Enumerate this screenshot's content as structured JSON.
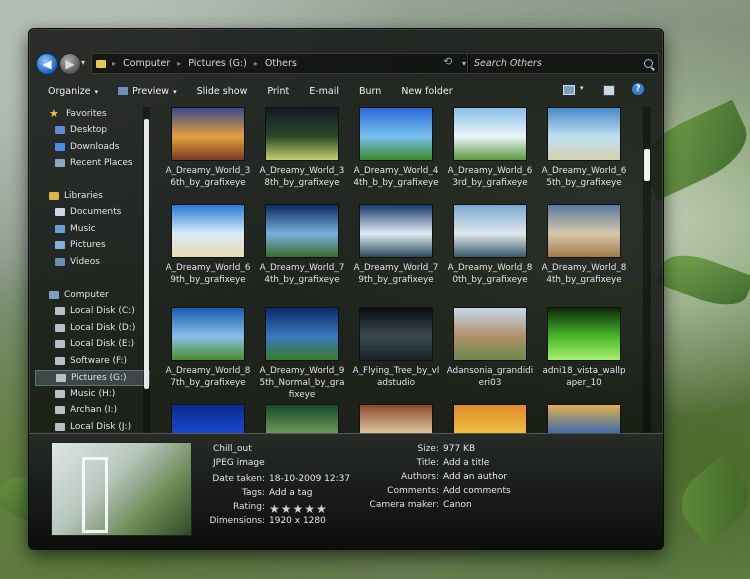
{
  "nav_buttons": {
    "back": "◀",
    "forward": "▶",
    "history": "▾"
  },
  "address": {
    "crumbs": [
      "Computer",
      "Pictures (G:)",
      "Others"
    ],
    "separator": "▸",
    "dropdown": "▾"
  },
  "search": {
    "placeholder": "Search Others"
  },
  "toolbar": {
    "items": [
      "Organize",
      "Preview",
      "Slide show",
      "Print",
      "E-mail",
      "Burn",
      "New folder"
    ],
    "arrow": "▾",
    "help": "?"
  },
  "nav": {
    "items": [
      {
        "label": "Favorites",
        "icon": "star-icon",
        "color": "#f4c430"
      },
      {
        "label": "Desktop",
        "icon": "desktop-icon",
        "color": "#5b8fd1"
      },
      {
        "label": "Downloads",
        "icon": "downloads-icon",
        "color": "#4a90e2"
      },
      {
        "label": "Recent Places",
        "icon": "recent-places-icon",
        "color": "#8fa8c2"
      },
      {
        "label": "Libraries",
        "icon": "libraries-icon",
        "color": "#d9b44a"
      },
      {
        "label": "Documents",
        "icon": "documents-icon",
        "color": "#cfd8e2"
      },
      {
        "label": "Music",
        "icon": "music-icon",
        "color": "#6aa0d8"
      },
      {
        "label": "Pictures",
        "icon": "pictures-icon",
        "color": "#7fb0e0"
      },
      {
        "label": "Videos",
        "icon": "videos-icon",
        "color": "#6c8cb0"
      },
      {
        "label": "Computer",
        "icon": "computer-icon",
        "color": "#7f9fbf"
      },
      {
        "label": "Local Disk (C:)",
        "icon": "disk-icon",
        "color": "#b8c0c8"
      },
      {
        "label": "Local Disk (D:)",
        "icon": "disk-icon",
        "color": "#b8c0c8"
      },
      {
        "label": "Local Disk (E:)",
        "icon": "disk-icon",
        "color": "#b8c0c8"
      },
      {
        "label": "Software (F:)",
        "icon": "disk-icon",
        "color": "#b8c0c8"
      },
      {
        "label": "Pictures (G:)",
        "icon": "disk-icon",
        "color": "#b8c0c8"
      },
      {
        "label": "Music (H:)",
        "icon": "disk-icon",
        "color": "#b8c0c8"
      },
      {
        "label": "Archan (I:)",
        "icon": "disk-icon",
        "color": "#b8c0c8"
      },
      {
        "label": "Local Disk (J:)",
        "icon": "disk-icon",
        "color": "#b8c0c8"
      }
    ]
  },
  "files": [
    {
      "name": "A_Dreamy_World_36th_by_grafixeye",
      "colors": [
        "#3a4a8a",
        "#e6a040",
        "#7a3a20"
      ]
    },
    {
      "name": "A_Dreamy_World_38th_by_grafixeye",
      "colors": [
        "#111a22",
        "#2a4a2a",
        "#c8d070"
      ]
    },
    {
      "name": "A_Dreamy_World_44th_b_by_grafixeye",
      "colors": [
        "#2a6ad8",
        "#7ac0f0",
        "#3a8a2a"
      ]
    },
    {
      "name": "A_Dreamy_World_63rd_by_grafixeye",
      "colors": [
        "#8ac0e8",
        "#eaf4fa",
        "#5a9a3a"
      ]
    },
    {
      "name": "A_Dreamy_World_65th_by_grafixeye",
      "colors": [
        "#4a8ac8",
        "#bfe0f0",
        "#d8d0b0"
      ]
    },
    {
      "name": "A_Dreamy_World_69th_by_grafixeye",
      "colors": [
        "#2a7ad0",
        "#d8ecf8",
        "#e8dcb0"
      ]
    },
    {
      "name": "A_Dreamy_World_74th_by_grafixeye",
      "colors": [
        "#0a2a5a",
        "#7ab0e0",
        "#3a6a2a"
      ]
    },
    {
      "name": "A_Dreamy_World_79th_by_grafixeye",
      "colors": [
        "#1a3a6a",
        "#e0ecf4",
        "#2a4a5a"
      ]
    },
    {
      "name": "A_Dreamy_World_80th_by_grafixeye",
      "colors": [
        "#7aa8d0",
        "#e0e8ee",
        "#3a5a6a"
      ]
    },
    {
      "name": "A_Dreamy_World_84th_by_grafixeye",
      "colors": [
        "#5a7aa0",
        "#d8c8a8",
        "#a07a4a"
      ]
    },
    {
      "name": "A_Dreamy_World_87th_by_grafixeye",
      "colors": [
        "#1a5ab0",
        "#8ac0e8",
        "#4a8a2a"
      ]
    },
    {
      "name": "A_Dreamy_World_95th_Normal_by_grafixeye",
      "colors": [
        "#0a2a6a",
        "#3a7ac0",
        "#3a7a2a"
      ]
    },
    {
      "name": "A_Flying_Tree_by_vladstudio",
      "colors": [
        "#0a0e12",
        "#3a4a52",
        "#1a2228"
      ]
    },
    {
      "name": "Adansonia_grandidieri03",
      "colors": [
        "#c8d8e8",
        "#b0906a",
        "#6a8a4a"
      ]
    },
    {
      "name": "adni18_vista_wallpaper_10",
      "colors": [
        "#0a2a0a",
        "#4ab82a",
        "#a8f070"
      ]
    },
    {
      "name": "",
      "colors": [
        "#0a2a8a",
        "#1a4ad0",
        "#0a1a5a"
      ]
    },
    {
      "name": "",
      "colors": [
        "#1a4a2a",
        "#6a9a5a",
        "#2a5a3a"
      ]
    },
    {
      "name": "",
      "colors": [
        "#8a4a2a",
        "#e0c8a0",
        "#b06a3a"
      ]
    },
    {
      "name": "",
      "colors": [
        "#e08a2a",
        "#f0c040",
        "#c04a2a"
      ]
    },
    {
      "name": "",
      "colors": [
        "#e0b050",
        "#3a6ab0",
        "#d05a3a"
      ]
    }
  ],
  "details": {
    "name": "Chill_out",
    "type": "JPEG image",
    "left": [
      {
        "key": "Date taken:",
        "value": "18-10-2009 12:37"
      },
      {
        "key": "Tags:",
        "value": "Add a tag"
      },
      {
        "key": "Rating:",
        "value": ""
      },
      {
        "key": "Dimensions:",
        "value": "1920 x 1280"
      }
    ],
    "right": [
      {
        "key": "Size:",
        "value": "977 KB"
      },
      {
        "key": "Title:",
        "value": "Add a title"
      },
      {
        "key": "Authors:",
        "value": "Add an author"
      },
      {
        "key": "Comments:",
        "value": "Add comments"
      },
      {
        "key": "Camera maker:",
        "value": "Canon"
      }
    ],
    "rating_stars": "★★★★★",
    "rating": 0
  }
}
